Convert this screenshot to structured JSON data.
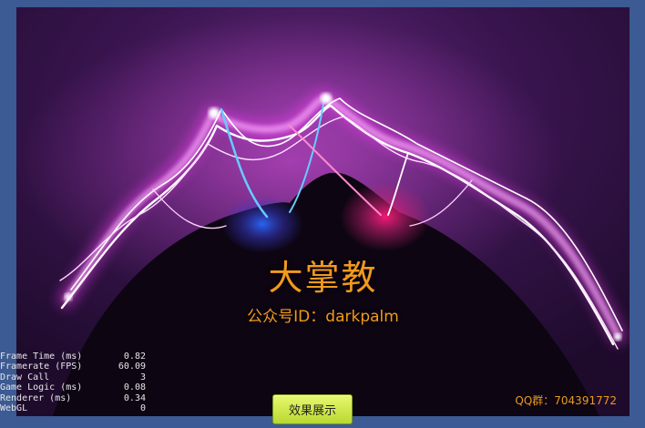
{
  "scene": {
    "title": "大掌教",
    "subtitle": "公众号ID：darkpalm",
    "qq": "QQ群：704391772"
  },
  "stats": [
    {
      "label": "Frame Time (ms)",
      "value": "0.82"
    },
    {
      "label": "Framerate (FPS)",
      "value": "60.09"
    },
    {
      "label": "Draw Call",
      "value": "3"
    },
    {
      "label": "Game Logic (ms)",
      "value": "0.08"
    },
    {
      "label": "Renderer (ms)",
      "value": "0.34"
    },
    {
      "label": "WebGL",
      "value": "0"
    }
  ],
  "button": {
    "label": "效果展示"
  },
  "colors": {
    "frame": "#3c5a93",
    "accent": "#f29a1c",
    "button": "#c8e646"
  }
}
